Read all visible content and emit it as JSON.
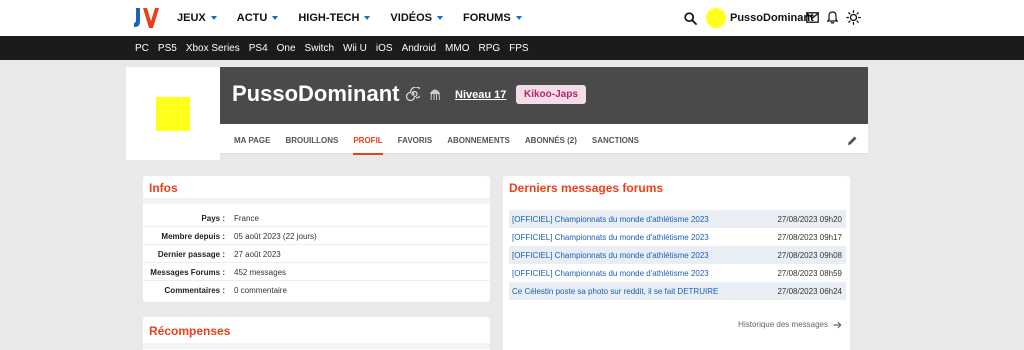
{
  "header": {
    "nav": [
      {
        "label": "JEUX"
      },
      {
        "label": "ACTU"
      },
      {
        "label": "HIGH-TECH"
      },
      {
        "label": "VIDÉOS"
      },
      {
        "label": "FORUMS"
      }
    ],
    "username": "PussoDominant"
  },
  "platforms": [
    "PC",
    "PS5",
    "Xbox Series",
    "PS4",
    "One",
    "Switch",
    "Wii U",
    "iOS",
    "Android",
    "MMO",
    "RPG",
    "FPS"
  ],
  "profile": {
    "name": "PussoDominant",
    "level": "Niveau 17",
    "badge": "Kikoo-Japs",
    "tabs": [
      "MA PAGE",
      "BROUILLONS",
      "PROFIL",
      "FAVORIS",
      "ABONNEMENTS",
      "ABONNÉS (2)",
      "SANCTIONS"
    ],
    "active_tab": "PROFIL"
  },
  "info": {
    "title": "Infos",
    "rows": [
      {
        "label": "Pays :",
        "value": "France"
      },
      {
        "label": "Membre depuis :",
        "value": "05 août 2023 (22 jours)"
      },
      {
        "label": "Dernier passage :",
        "value": "27 août 2023"
      },
      {
        "label": "Messages Forums :",
        "value": "452 messages"
      },
      {
        "label": "Commentaires :",
        "value": "0 commentaire"
      }
    ]
  },
  "rewards": {
    "title": "Récompenses"
  },
  "messages": {
    "title": "Derniers messages forums",
    "rows": [
      {
        "topic": "[OFFICIEL] Championnats du monde d'athlétisme 2023",
        "date": "27/08/2023 09h20"
      },
      {
        "topic": "[OFFICIEL] Championnats du monde d'athlétisme 2023",
        "date": "27/08/2023 09h17"
      },
      {
        "topic": "[OFFICIEL] Championnats du monde d'athlétisme 2023",
        "date": "27/08/2023 09h08"
      },
      {
        "topic": "[OFFICIEL] Championnats du monde d'athlétisme 2023",
        "date": "27/08/2023 08h59"
      },
      {
        "topic": "Ce Célestin poste sa photo sur reddit, il se fait DETRUIRE",
        "date": "27/08/2023 06h24"
      }
    ],
    "history_label": "Historique des messages"
  },
  "colors": {
    "accent": "#e8411a",
    "link": "#1a5fb4",
    "avatar": "#ffff1c",
    "banner": "#4a4a4a"
  }
}
